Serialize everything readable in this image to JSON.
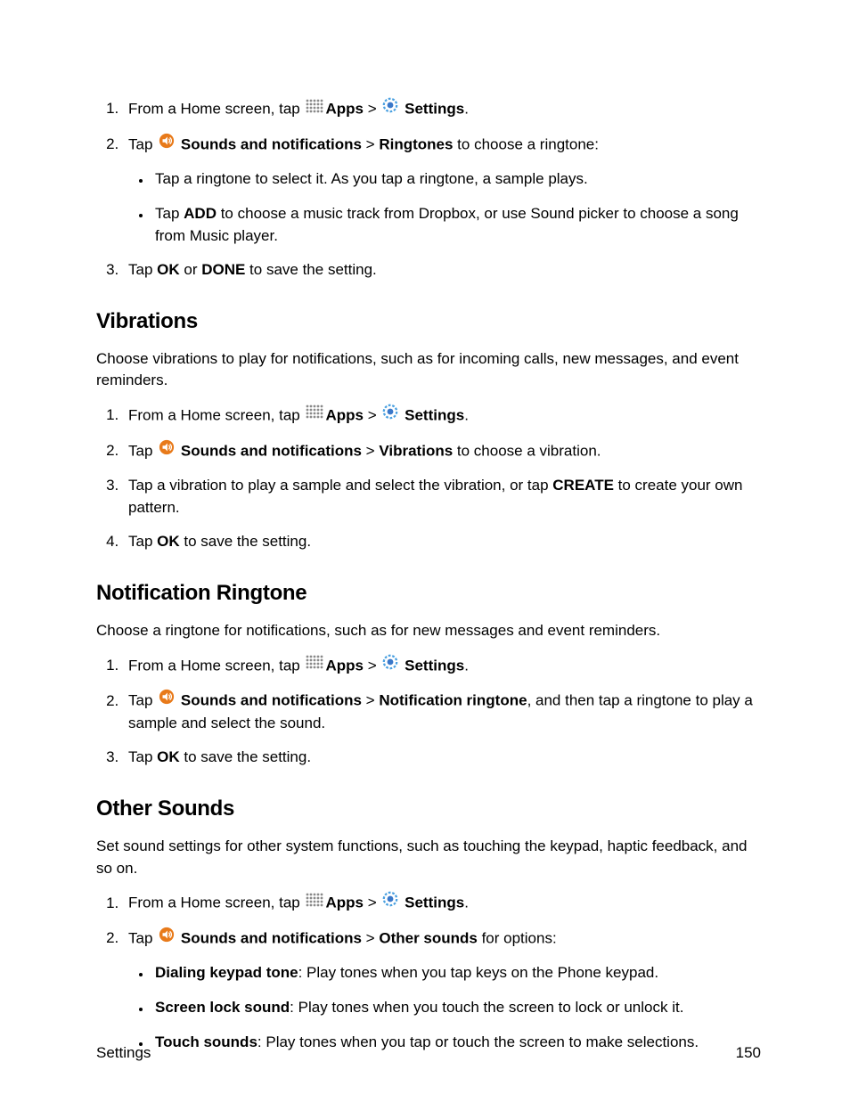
{
  "step_home_prefix": "From a Home screen, tap",
  "apps_label": "Apps",
  "gt": ">",
  "settings_label": "Settings",
  "dot": ".",
  "tap_word": "Tap ",
  "s1_sounds": "Sounds and notifications",
  "s1_ringtones": "Ringtones",
  "s1_ringtones_rest": " to choose a ringtone:",
  "s1_sub1": "Tap a ringtone to select it. As you tap a ringtone, a sample plays.",
  "s1_sub2_tap": "Tap ",
  "s1_sub2_add": "ADD",
  "s1_sub2_rest": " to choose a music track from Dropbox, or use Sound picker to choose a song from Music player.",
  "s1_step3_tap": "Tap ",
  "s1_step3_ok": "OK",
  "s1_step3_or": " or ",
  "s1_step3_done": "DONE",
  "s1_step3_rest": " to save the setting.",
  "h_vibrations": "Vibrations",
  "vib_intro": "Choose vibrations to play for notifications, such as for incoming calls, new messages, and event reminders.",
  "vib_s2_vibrations": "Vibrations",
  "vib_s2_rest": " to choose a vibration.",
  "vib_s3_a": "Tap a vibration to play a sample and select the vibration, or tap ",
  "vib_s3_create": "CREATE",
  "vib_s3_b": " to create your own pattern.",
  "vib_s4_tap": "Tap ",
  "vib_s4_ok": "OK",
  "vib_s4_rest": " to save the setting.",
  "h_notif": "Notification Ringtone",
  "notif_intro": "Choose a ringtone for notifications, such as for new messages and event reminders.",
  "notif_s2_nr": "Notification ringtone",
  "notif_s2_rest": ", and then tap a ringtone to play a sample and select the sound.",
  "notif_s3_tap": "Tap ",
  "notif_s3_ok": "OK",
  "notif_s3_rest": " to save the setting.",
  "h_other": "Other Sounds",
  "other_intro": "Set sound settings for other system functions, such as touching the keypad, haptic feedback, and so on.",
  "other_s2_os": "Other sounds",
  "other_s2_rest": " for options:",
  "other_b1_t": "Dialing keypad tone",
  "other_b1_r": ": Play tones when you tap keys on the Phone keypad.",
  "other_b2_t": "Screen lock sound",
  "other_b2_r": ": Play tones when you touch the screen to lock or unlock it.",
  "other_b3_t": "Touch sounds",
  "other_b3_r": ": Play tones when you tap or touch the screen to make selections.",
  "footer_left": "Settings",
  "footer_right": "150"
}
